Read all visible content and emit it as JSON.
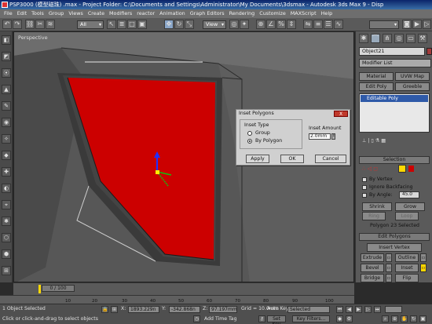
{
  "window": {
    "title": "PSP3000 (模型磁珠) .max  - Project Folder: C:\\Documents and Settings\\Administrator\\My Documents\\3dsmax  - Autodesk 3ds Max 9  - Disp"
  },
  "menu": [
    "File",
    "Edit",
    "Tools",
    "Group",
    "Views",
    "Create",
    "Modifiers",
    "reactor",
    "Animation",
    "Graph Editors",
    "Rendering",
    "Customize",
    "MAXScript",
    "Help"
  ],
  "toolbar": {
    "selection_filter": "All",
    "reference_coord": "View"
  },
  "viewport": {
    "label": "Perspective",
    "selected_face_color": "#cc0000"
  },
  "panel": {
    "object_name": "Object21",
    "modifier_list": "Modifier List",
    "buttons": [
      "Material",
      "UVW Map",
      "Edit Poly",
      "Greeble"
    ],
    "stack_item": "Editable Poly",
    "selection_title": "Selection",
    "by_vertex": "By Vertex",
    "ignore_backfacing": "Ignore Backfacing",
    "by_angle": "By Angle:",
    "by_angle_value": "45.0",
    "shrink": "Shrink",
    "grow": "Grow",
    "ring": "Ring",
    "loop": "Loop",
    "selected_status": "Polygon 23 Selected",
    "edit_polygons_title": "Edit Polygons",
    "insert_vertex": "Insert Vertex",
    "extrude": "Extrude",
    "outline": "Outline",
    "bevel": "Bevel",
    "inset": "Inset",
    "bridge": "Bridge",
    "flip": "Flip",
    "hinge_from_edge": "Hinge From Edge",
    "extrude_along_spline": "Extrude Along Spline"
  },
  "dialog": {
    "title": "Inset Polygons",
    "close": "X",
    "inset_type_label": "Inset Type",
    "option_group": "Group",
    "option_by_polygon": "By Polygon",
    "selected_option": "By Polygon",
    "amount_label": "Inset Amount",
    "amount_value": "2.0mm",
    "apply": "Apply",
    "ok": "OK",
    "cancel": "Cancel"
  },
  "timeline": {
    "frame_counter": "0 / 100",
    "ticks": [
      "0",
      "10",
      "20",
      "30",
      "40",
      "50",
      "60",
      "70",
      "80",
      "90",
      "100"
    ]
  },
  "status": {
    "selection_info": "1 Object Selected",
    "prompt": "Click or click-and-drag to select objects",
    "x_label": "X:",
    "x_value": "1893.229n",
    "y_label": "Y:",
    "y_value": "-342.868n",
    "z_label": "Z:",
    "z_value": "97.197mm",
    "grid": "Grid = 10.0mm",
    "add_time_tag": "Add Time Tag",
    "auto_key": "Auto Key",
    "set_key": "Set Key",
    "key_mode": "Selected",
    "key_filters": "Key Filters..."
  }
}
